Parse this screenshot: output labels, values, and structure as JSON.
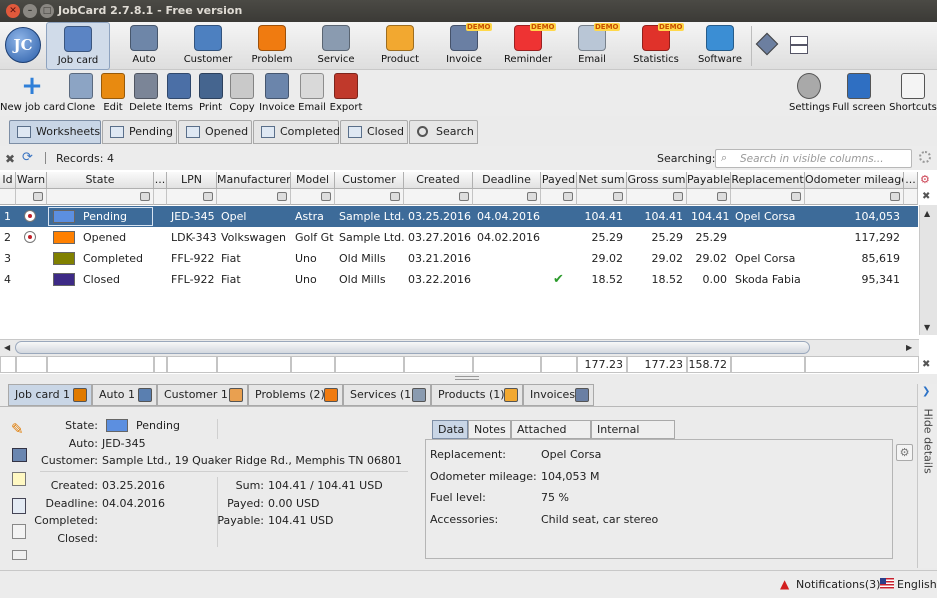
{
  "window": {
    "title": "JobCard 2.7.8.1 - Free version"
  },
  "main_toolbar": [
    {
      "label": "Job card",
      "icon": "job-card-icon",
      "color": "#5b84c4"
    },
    {
      "label": "Auto",
      "icon": "gear-icon",
      "color": "#6e86a8"
    },
    {
      "label": "Customer",
      "icon": "customer-icon",
      "color": "#4d80c0"
    },
    {
      "label": "Problem",
      "icon": "warning-icon",
      "color": "#f07b10"
    },
    {
      "label": "Service",
      "icon": "wrench-icon",
      "color": "#8a9bb0"
    },
    {
      "label": "Product",
      "icon": "box-icon",
      "color": "#f2a830"
    },
    {
      "label": "Invoice",
      "icon": "invoice-icon",
      "color": "#6a7fa3",
      "badge": "DEMO"
    },
    {
      "label": "Reminder",
      "icon": "clock-icon",
      "color": "#e33",
      "badge": "DEMO"
    },
    {
      "label": "Email",
      "icon": "email-icon",
      "color": "#b9c6d6",
      "badge": "DEMO"
    },
    {
      "label": "Statistics",
      "icon": "pie-chart-icon",
      "color": "#e0322a",
      "badge": "DEMO"
    },
    {
      "label": "Software",
      "icon": "software-icon",
      "color": "#3b8ed4"
    }
  ],
  "action_toolbar": [
    {
      "label": "New job card",
      "icon": "plus-icon"
    },
    {
      "label": "Clone",
      "icon": "clone-icon"
    },
    {
      "label": "Edit",
      "icon": "pencil-icon"
    },
    {
      "label": "Delete",
      "icon": "delete-icon"
    },
    {
      "label": "Items",
      "icon": "list-icon"
    },
    {
      "label": "Print",
      "icon": "printer-icon"
    },
    {
      "label": "Copy",
      "icon": "copy-icon"
    },
    {
      "label": "Invoice",
      "icon": "invoice-icon"
    },
    {
      "label": "Email",
      "icon": "email-icon"
    },
    {
      "label": "Export",
      "icon": "export-icon"
    }
  ],
  "right_toolbar": [
    {
      "label": "Settings",
      "icon": "gear-icon"
    },
    {
      "label": "Full screen",
      "icon": "fullscreen-icon"
    },
    {
      "label": "Shortcuts",
      "icon": "keyboard-icon"
    }
  ],
  "view_tabs": [
    "Worksheets",
    "Pending",
    "Opened",
    "Completed",
    "Closed",
    "Search"
  ],
  "grid": {
    "records_label": "Records: 4",
    "searching_label": "Searching:",
    "search_placeholder": "Search in visible columns...",
    "columns": [
      "Id",
      "Warn",
      "State",
      "...",
      "LPN",
      "Manufacturer",
      "Model",
      "Customer",
      "Created",
      "Deadline",
      "Payed",
      "Net sum",
      "Gross sum",
      "Payable",
      "Replacement",
      "Odometer mileage",
      "..."
    ],
    "rows": [
      {
        "id": "1",
        "warn": true,
        "state": "Pending",
        "state_color": "#5c8fe0",
        "lpn": "JED-345",
        "manufacturer": "Opel",
        "model": "Astra",
        "customer": "Sample Ltd.",
        "created": "03.25.2016",
        "deadline": "04.04.2016",
        "payed": "",
        "net": "104.41",
        "gross": "104.41",
        "payable": "104.41",
        "replacement": "Opel Corsa",
        "odometer": "104,053",
        "selected": true
      },
      {
        "id": "2",
        "warn": true,
        "state": "Opened",
        "state_color": "#ff8000",
        "lpn": "LDK-343",
        "manufacturer": "Volkswagen",
        "model": "Golf Gt",
        "customer": "Sample Ltd.",
        "created": "03.27.2016",
        "deadline": "04.02.2016",
        "payed": "",
        "net": "25.29",
        "gross": "25.29",
        "payable": "25.29",
        "replacement": "",
        "odometer": "117,292",
        "selected": false
      },
      {
        "id": "3",
        "warn": false,
        "state": "Completed",
        "state_color": "#808000",
        "lpn": "FFL-922",
        "manufacturer": "Fiat",
        "model": "Uno",
        "customer": "Old Mills",
        "created": "03.21.2016",
        "deadline": "",
        "payed": "",
        "net": "29.02",
        "gross": "29.02",
        "payable": "29.02",
        "replacement": "Opel Corsa",
        "odometer": "85,619",
        "selected": false
      },
      {
        "id": "4",
        "warn": false,
        "state": "Closed",
        "state_color": "#3d2a86",
        "lpn": "FFL-922",
        "manufacturer": "Fiat",
        "model": "Uno",
        "customer": "Old Mills",
        "created": "03.22.2016",
        "deadline": "",
        "payed": "check",
        "net": "18.52",
        "gross": "18.52",
        "payable": "0.00",
        "replacement": "Skoda Fabia",
        "odometer": "95,341",
        "selected": false
      }
    ],
    "totals": {
      "net": "177.23",
      "gross": "177.23",
      "payable": "158.72"
    }
  },
  "detail_tabs": [
    "Job card 1",
    "Auto 1",
    "Customer 1",
    "Problems (2)",
    "Services (1)",
    "Products (1)",
    "Invoices"
  ],
  "detail": {
    "state_label": "State:",
    "state_value": "Pending",
    "state_color": "#5c8fe0",
    "auto_label": "Auto:",
    "auto_value": "JED-345",
    "customer_label": "Customer:",
    "customer_value": "Sample Ltd., 19 Quaker Ridge Rd., Memphis TN 06801",
    "created_label": "Created:",
    "created_value": "03.25.2016",
    "deadline_label": "Deadline:",
    "deadline_value": "04.04.2016",
    "completed_label": "Completed:",
    "completed_value": "",
    "closed_label": "Closed:",
    "closed_value": "",
    "sum_label": "Sum:",
    "sum_value": "104.41 / 104.41 USD",
    "payed_label": "Payed:",
    "payed_value": "0.00 USD",
    "payable_label": "Payable:",
    "payable_value": "104.41 USD"
  },
  "note_tabs": [
    "Data",
    "Notes",
    "Attached files",
    "Internal notes"
  ],
  "data_panel": [
    {
      "label": "Replacement:",
      "value": "Opel Corsa"
    },
    {
      "label": "Odometer mileage:",
      "value": "104,053 M"
    },
    {
      "label": "Fuel level:",
      "value": "75 %"
    },
    {
      "label": "Accessories:",
      "value": "Child seat, car stereo"
    }
  ],
  "hide_details": "Hide details",
  "status": {
    "notifications": "Notifications(3)",
    "language": "English"
  }
}
